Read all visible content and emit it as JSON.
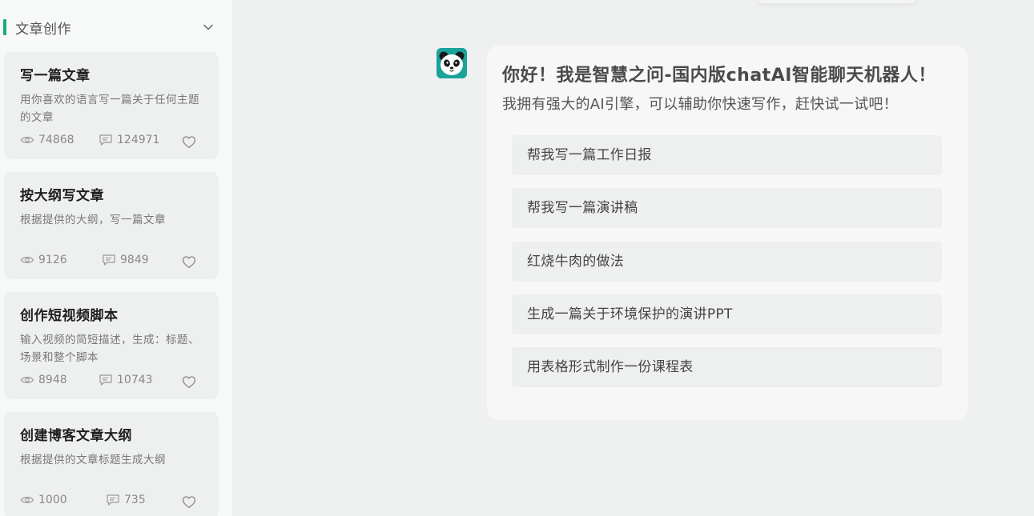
{
  "sidebar": {
    "section_title": "文章创作",
    "cards": [
      {
        "title": "写一篇文章",
        "desc": "用你喜欢的语言写一篇关于任何主题的文章",
        "views": "74868",
        "comments": "124971"
      },
      {
        "title": "按大纲写文章",
        "desc": "根据提供的大纲，写一篇文章",
        "views": "9126",
        "comments": "9849"
      },
      {
        "title": "创作短视频脚本",
        "desc": "输入视频的简短描述，生成：标题、场景和整个脚本",
        "views": "8948",
        "comments": "10743"
      },
      {
        "title": "创建博客文章大纲",
        "desc": "根据提供的文章标题生成大纲",
        "views": "1000",
        "comments": "735"
      }
    ]
  },
  "chat": {
    "greeting_title": "你好！我是智慧之问-国内版chatAI智能聊天机器人！",
    "greeting_subtitle": "我拥有强大的AI引擎，可以辅助你快速写作，赶快试一试吧！",
    "suggestions": [
      "帮我写一篇工作日报",
      "帮我写一篇演讲稿",
      "红烧牛肉的做法",
      "生成一篇关于环境保护的演讲PPT",
      "用表格形式制作一份课程表"
    ]
  },
  "colors": {
    "accent": "#1aaa7e",
    "avatar_bg": "#19a39b"
  },
  "icons": [
    "chevron-down-icon",
    "eye-icon",
    "comment-icon",
    "heart-icon",
    "panda-avatar"
  ]
}
